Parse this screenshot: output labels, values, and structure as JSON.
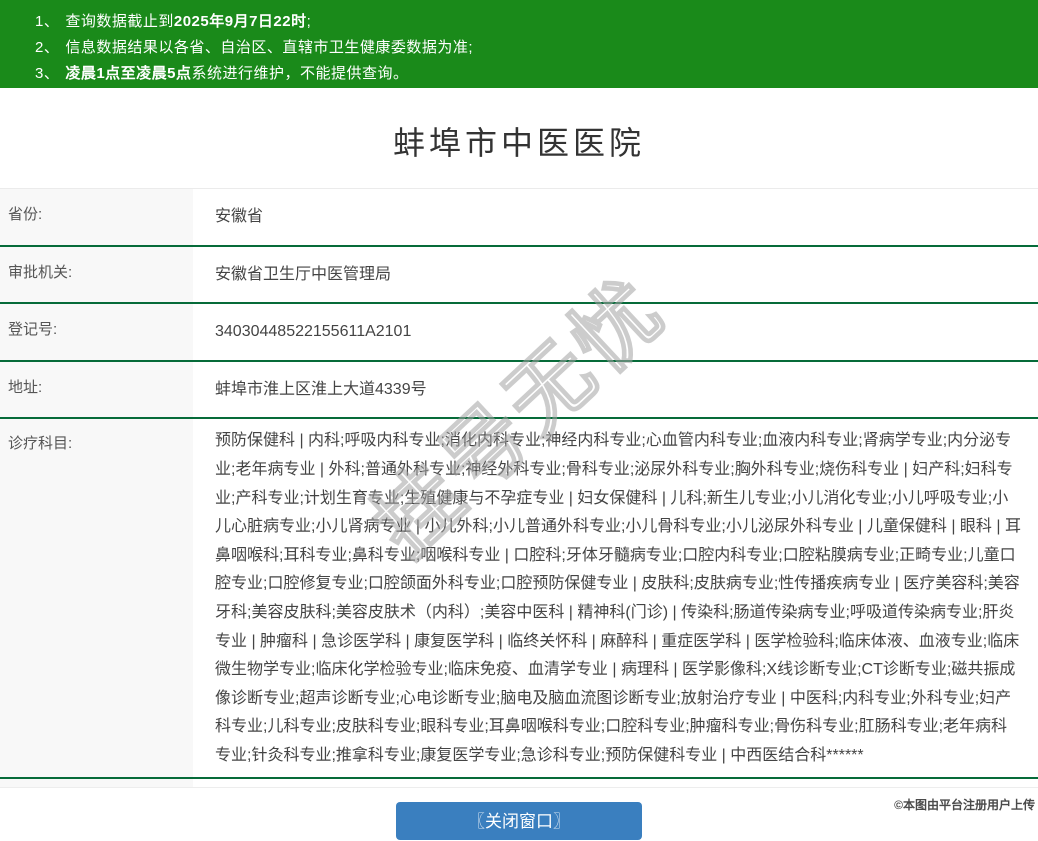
{
  "notice": {
    "items": [
      {
        "num": "1、",
        "pre": "查询数据截止到",
        "bold": "2025年9月7日22时",
        "post": ";"
      },
      {
        "num": "2、",
        "pre": "信息数据结果以各省、自治区、直辖市卫生健康委数据为准;",
        "bold": "",
        "post": ""
      },
      {
        "num": "3、",
        "pre": "",
        "bold": "凌晨1点至凌晨5点",
        "post": "系统进行维护，不能提供查询。"
      }
    ]
  },
  "hospital": {
    "title": "蚌埠市中医医院"
  },
  "table": {
    "rows": [
      {
        "label": "省份:",
        "value": "安徽省"
      },
      {
        "label": "审批机关:",
        "value": "安徽省卫生厅中医管理局"
      },
      {
        "label": "登记号:",
        "value": "34030448522155611A2101"
      },
      {
        "label": "地址:",
        "value": "蚌埠市淮上区淮上大道4339号"
      },
      {
        "label": "诊疗科目:",
        "value": "预防保健科 | 内科;呼吸内科专业;消化内科专业;神经内科专业;心血管内科专业;血液内科专业;肾病学专业;内分泌专业;老年病专业 | 外科;普通外科专业;神经外科专业;骨科专业;泌尿外科专业;胸外科专业;烧伤科专业 | 妇产科;妇科专业;产科专业;计划生育专业;生殖健康与不孕症专业 | 妇女保健科 | 儿科;新生儿专业;小儿消化专业;小儿呼吸专业;小儿心脏病专业;小儿肾病专业 | 小儿外科;小儿普通外科专业;小儿骨科专业;小儿泌尿外科专业 | 儿童保健科 | 眼科 | 耳鼻咽喉科;耳科专业;鼻科专业;咽喉科专业 | 口腔科;牙体牙髓病专业;口腔内科专业;口腔粘膜病专业;正畸专业;儿童口腔专业;口腔修复专业;口腔颌面外科专业;口腔预防保健专业 | 皮肤科;皮肤病专业;性传播疾病专业 | 医疗美容科;美容牙科;美容皮肤科;美容皮肤术（内科）;美容中医科 | 精神科(门诊) | 传染科;肠道传染病专业;呼吸道传染病专业;肝炎专业 | 肿瘤科 | 急诊医学科 | 康复医学科 | 临终关怀科 | 麻醉科 | 重症医学科 | 医学检验科;临床体液、血液专业;临床微生物学专业;临床化学检验专业;临床免疫、血清学专业 | 病理科 | 医学影像科;X线诊断专业;CT诊断专业;磁共振成像诊断专业;超声诊断专业;心电诊断专业;脑电及脑血流图诊断专业;放射治疗专业 | 中医科;内科专业;外科专业;妇产科专业;儿科专业;皮肤科专业;眼科专业;耳鼻咽喉科专业;口腔科专业;肿瘤科专业;骨伤科专业;肛肠科专业;老年病科专业;针灸科专业;推拿科专业;康复医学专业;急诊科专业;预防保健科专业 | 中西医结合科******"
      }
    ]
  },
  "close_button": {
    "label": "〖关闭窗口〗"
  },
  "watermark": {
    "text": "挂号无忧"
  },
  "footer": {
    "credit": "©本图由平台注册用户上传"
  },
  "colors": {
    "banner_green": "#1a8a1a",
    "divider_green": "#066b39",
    "button_blue": "#3a7fbf",
    "label_bg": "#f8f8f8"
  }
}
